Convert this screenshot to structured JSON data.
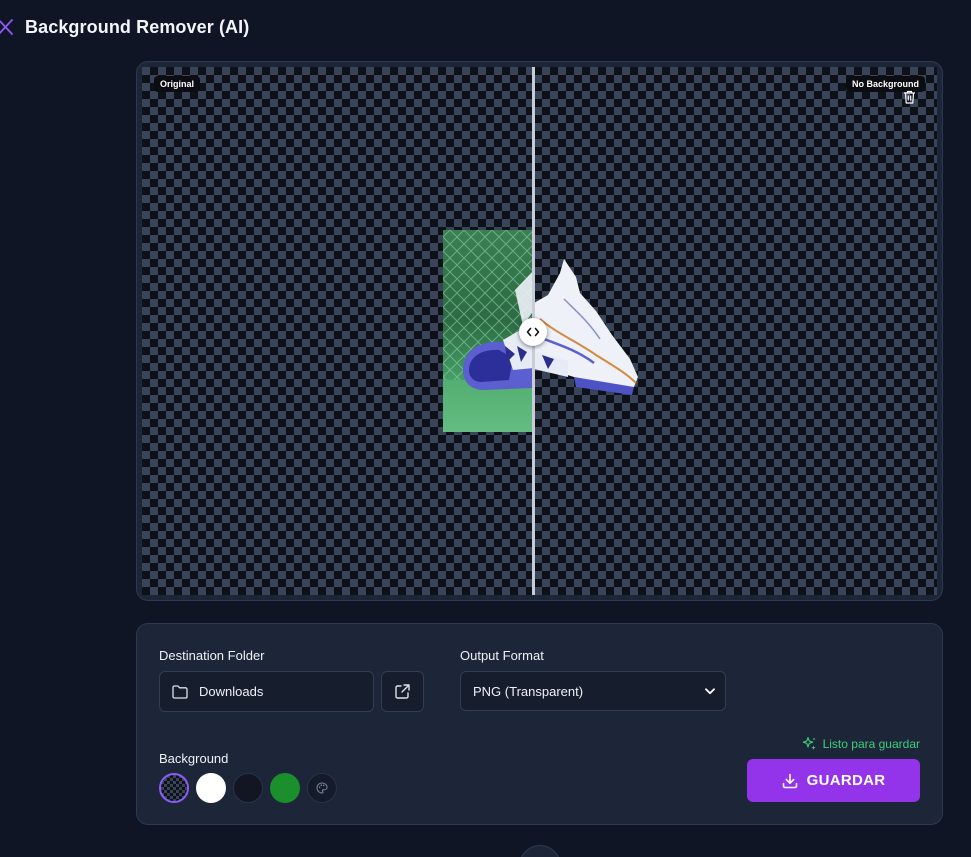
{
  "app": {
    "title": "Background Remover (AI)",
    "accent_color": "#9333ea",
    "logo_icon": "scissors-icon"
  },
  "preview": {
    "left_label": "Original",
    "right_label": "No Background",
    "delete_icon": "trash-icon",
    "compare_handle_icon": "chevron-left-right-icon",
    "background": "transparent-checkerboard"
  },
  "settings": {
    "destination": {
      "label": "Destination Folder",
      "value": "Downloads",
      "folder_icon": "folder-icon",
      "open_icon": "external-link-icon"
    },
    "output_format": {
      "label": "Output Format",
      "selected": "PNG (Transparent)"
    },
    "background": {
      "label": "Background",
      "selected": "transparent",
      "options": [
        {
          "name": "transparent",
          "color": "checkerboard"
        },
        {
          "name": "white",
          "color": "#ffffff"
        },
        {
          "name": "black",
          "color": "#111622"
        },
        {
          "name": "green",
          "color": "#1a8f2b"
        },
        {
          "name": "custom",
          "icon": "palette-icon"
        }
      ]
    },
    "status": {
      "text": "Listo para guardar",
      "icon": "sparkles-icon",
      "color": "#3ecf7a"
    },
    "save": {
      "label": "GUARDAR",
      "icon": "download-icon"
    }
  }
}
